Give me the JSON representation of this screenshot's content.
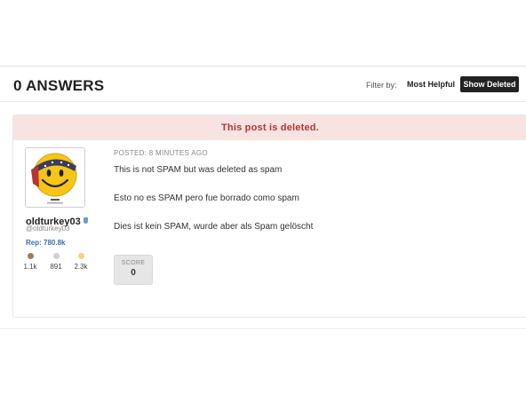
{
  "header": {
    "answers_title": "0 ANSWERS",
    "filter_label": "Filter by:",
    "filter_most_helpful": "Most Helpful",
    "filter_show_deleted": "Show Deleted"
  },
  "answer": {
    "deleted_banner": "This post is deleted.",
    "author": {
      "username": "oldturkey03",
      "handle": "@oldturkey03",
      "reputation": "Rep: 780.8k",
      "badges": [
        {
          "name": "bronze",
          "color": "#9b7e5a",
          "count": "1.1k"
        },
        {
          "name": "silver",
          "color": "#cfcfcf",
          "count": "891"
        },
        {
          "name": "gold",
          "color": "#f0d77a",
          "count": "2.3k"
        }
      ]
    },
    "posted": "POSTED: 8 MINUTES AGO",
    "lines": [
      "This is not SPAM but was deleted as spam",
      "Esto no es SPAM pero fue borrado como spam",
      "Dies ist kein SPAM, wurde aber als Spam gelöscht"
    ],
    "score_label": "SCORE",
    "score_value": "0"
  }
}
